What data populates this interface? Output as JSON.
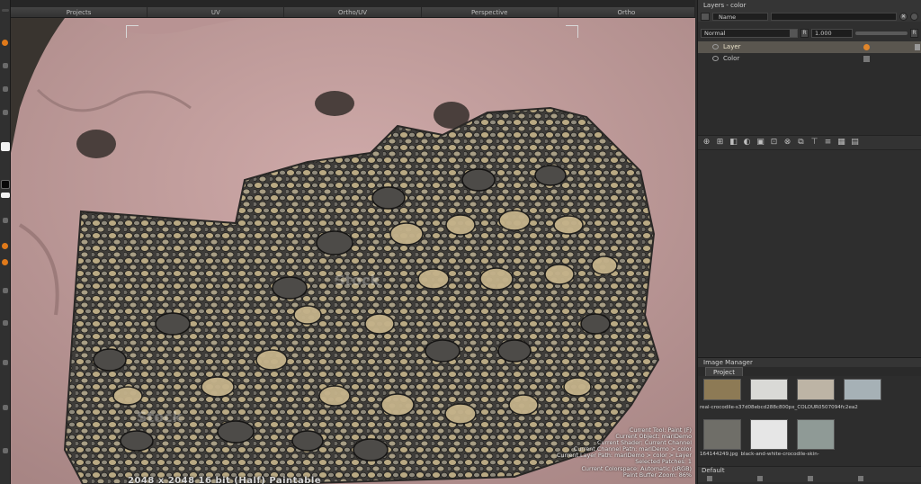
{
  "viewport": {
    "tabs": [
      "Projects",
      "UV",
      "Ortho/UV",
      "Perspective",
      "Ortho"
    ],
    "hud_lines": [
      "Current Tool: Paint (F)",
      "Current Object: mariDemo",
      "Current Shader: Current Channel",
      "Current Channel Path: mariDemo > color",
      "Current Layer Path: mariDemo > color > Layer",
      "Selected Patches: 1",
      "Current Colorspace: Automatic (sRGB)",
      "Paint Buffer Zoom: 86%"
    ],
    "bottom_info": "2048 x 2048 16 bit (Half) Paintable",
    "watermark": "Stock",
    "colors": {
      "skin": "#c9a4a3",
      "skin_shadow": "#a98686",
      "scales": "#4e4c4a",
      "scale_light": "#c8b58c"
    }
  },
  "layers_panel": {
    "title": "Layers - color",
    "filter_select": "Name",
    "blend_mode": "Normal",
    "r_button": "R",
    "opacity": "1.000",
    "layers": [
      {
        "name": "Layer",
        "selected": true
      },
      {
        "name": "Color",
        "selected": false
      }
    ],
    "close_symbol": "✕"
  },
  "image_manager": {
    "title": "Image Manager",
    "tab": "Project",
    "row1_label": "real-crocodile-s37d08ebcd288c800px_COLOUR0507094fc2ea2",
    "row2_labels": [
      "164144249.jpg",
      "black-and-white-crocodile-skin-"
    ],
    "default_label": "Default",
    "thumb_colors_row1": [
      "#8d7a55",
      "#d9d9d6",
      "#bdb4a5",
      "#a6b1b6"
    ],
    "thumb_colors_row2": [
      "#6f6e68",
      "#e6e6e6",
      "#8f9a96"
    ]
  }
}
